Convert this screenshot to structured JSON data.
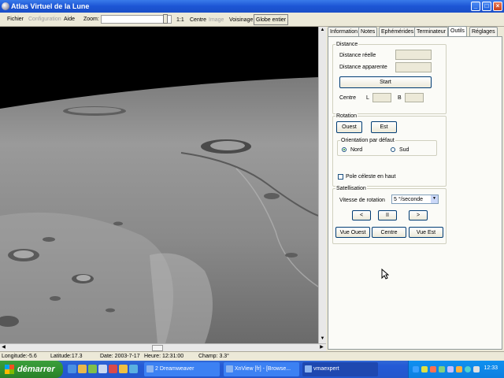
{
  "window": {
    "title": "Atlas Virtuel de la Lune",
    "controls": {
      "minimize": "_",
      "maximize": "□",
      "close": "×"
    }
  },
  "menu": {
    "fichier": "Fichier",
    "configuration": "Configuration",
    "aide": "Aide"
  },
  "toolbar": {
    "zoom_label": "Zoom:",
    "ratio": "1:1",
    "centre": "Centre",
    "image": "Image",
    "voisinage": "Voisinage",
    "globe": "Globe entier",
    "zoom_level": 0.95
  },
  "tabs": [
    "Information",
    "Notes",
    "Ephémérides",
    "Terminateur",
    "Outils",
    "Réglages"
  ],
  "active_tab": "Outils",
  "outils": {
    "distance": {
      "title": "Distance",
      "reelle": "Distance réelle",
      "apparente": "Distance apparente",
      "start": "Start",
      "centre": "Centre",
      "l": "L",
      "b": "B"
    },
    "rotation": {
      "title": "Rotation",
      "ouest": "Ouest",
      "est": "Est",
      "orientation": "Orientation par défaut",
      "nord": "Nord",
      "sud": "Sud",
      "selected": "Nord",
      "pole": "Pole céleste en haut",
      "pole_checked": false
    },
    "satellisation": {
      "title": "Satellisation",
      "vitesse": "Vitesse de rotation",
      "speed": "5 °/seconde",
      "prev": "<",
      "pause": "II",
      "next": ">",
      "vue_ouest": "Vue Ouest",
      "centre": "Centre",
      "vue_est": "Vue Est"
    }
  },
  "status": {
    "longitude": "Longitude:-5.6",
    "latitude": "Latitude:17.3",
    "date": "Date: 2003-7-17",
    "heure": "Heure: 12:31:00",
    "champ": "Champ: 3.3°"
  },
  "taskbar": {
    "start": "démarrer",
    "tasks": [
      "2 Dreamweaver",
      "XnView [fr] - [Browse...",
      "vmaexpert"
    ],
    "active_task": "vmaexpert",
    "clock": "12:33"
  }
}
